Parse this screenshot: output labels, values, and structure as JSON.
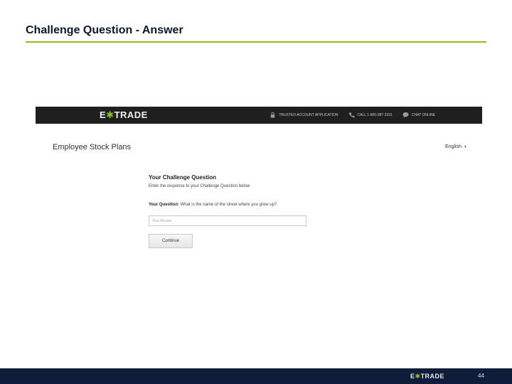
{
  "slide": {
    "title": "Challenge Question - Answer",
    "page_number": "44"
  },
  "header": {
    "logo_left": "E",
    "logo_plus": "✱",
    "logo_right": "TRADE",
    "links": [
      {
        "icon": "lock-icon",
        "label": "Trusted account application"
      },
      {
        "icon": "phone-icon",
        "label": "Call 1-800-387-2331"
      },
      {
        "icon": "chat-icon",
        "label": "Chat online"
      }
    ]
  },
  "page": {
    "title": "Employee Stock Plans",
    "language": "English"
  },
  "form": {
    "heading": "Your Challenge Question",
    "instruction": "Enter the response to your Challenge Question below",
    "question_label": "Your Question:",
    "question_text": "What is the name of the street where you grew up?",
    "answer_placeholder": "Your Answer",
    "answer_value": "",
    "continue_label": "Continue"
  },
  "footer": {
    "logo_left": "E",
    "logo_plus": "✱",
    "logo_right": "TRADE"
  },
  "colors": {
    "accent_green": "#8cbf26",
    "footer_navy": "#0f1d3a",
    "header_dark": "#1f1f1f"
  }
}
